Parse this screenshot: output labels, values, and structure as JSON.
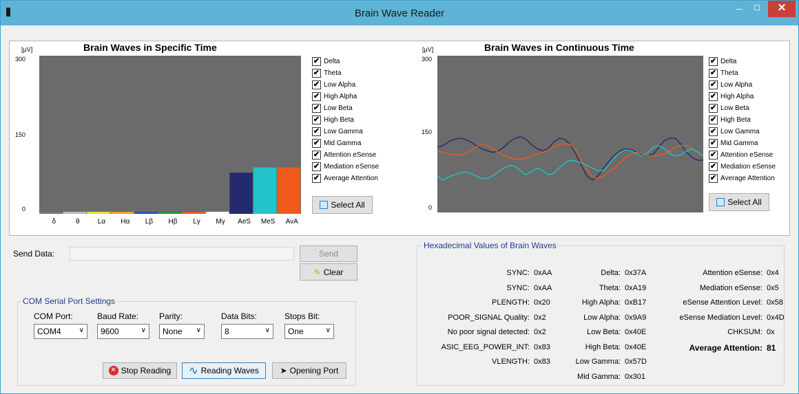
{
  "window": {
    "title": "Brain Wave Reader",
    "min": "–",
    "max": "☐",
    "close": "✕"
  },
  "chart_data": [
    {
      "type": "bar",
      "title": "Brain Waves in Specific Time",
      "unit": "[µV]",
      "ylim": [
        0,
        300
      ],
      "yticks": [
        "300",
        "150",
        "0"
      ],
      "categories": [
        "δ",
        "θ",
        "Lα",
        "Hα",
        "Lβ",
        "Hβ",
        "Lγ",
        "Mγ",
        "AeS",
        "MeS",
        "AvA"
      ],
      "values": [
        4,
        4,
        4,
        4,
        4,
        4,
        4,
        4,
        78,
        88,
        88
      ],
      "colors": [
        "#7a7a7a",
        "#bdbdbd",
        "#e6e02a",
        "#f0a020",
        "#3050b0",
        "#2e8b3a",
        "#e85a1a",
        "#ffffff",
        "#232a6e",
        "#22c3c9",
        "#f0581e"
      ]
    },
    {
      "type": "line",
      "title": "Brain Waves in Continuous Time",
      "unit": "[µV]",
      "ylim": [
        0,
        300
      ],
      "yticks": [
        "300",
        "150",
        "0"
      ],
      "x": [
        0,
        1,
        2,
        3,
        4,
        5,
        6,
        7,
        8,
        9,
        10,
        11,
        12,
        13,
        14,
        15,
        16,
        17,
        18,
        19,
        20,
        21,
        22,
        23,
        24,
        25,
        26,
        27,
        28,
        29,
        30,
        31,
        32,
        33,
        34,
        35,
        36,
        37,
        38,
        39,
        40,
        41,
        42,
        43,
        44,
        45,
        46,
        47,
        48
      ],
      "series": [
        {
          "color": "#232a6e",
          "values": [
            125,
            128,
            135,
            140,
            142,
            140,
            135,
            128,
            122,
            118,
            115,
            118,
            125,
            135,
            142,
            145,
            140,
            130,
            122,
            118,
            122,
            135,
            142,
            140,
            130,
            112,
            90,
            70,
            62,
            70,
            85,
            98,
            110,
            118,
            122,
            120,
            115,
            110,
            108,
            112,
            125,
            138,
            142,
            142,
            130,
            115,
            105,
            100,
            100
          ]
        },
        {
          "color": "#f0581e",
          "values": [
            118,
            115,
            112,
            110,
            110,
            112,
            118,
            125,
            130,
            128,
            122,
            115,
            110,
            105,
            102,
            102,
            104,
            108,
            112,
            115,
            120,
            125,
            130,
            132,
            130,
            120,
            100,
            82,
            68,
            65,
            70,
            78,
            85,
            95,
            105,
            112,
            115,
            112,
            108,
            108,
            110,
            112,
            118,
            125,
            128,
            128,
            122,
            115,
            110
          ]
        },
        {
          "color": "#22c3c9",
          "values": [
            70,
            62,
            68,
            72,
            75,
            78,
            75,
            70,
            65,
            65,
            70,
            78,
            85,
            90,
            88,
            80,
            72,
            78,
            85,
            80,
            72,
            75,
            85,
            95,
            100,
            98,
            95,
            90,
            85,
            80,
            80,
            92,
            105,
            115,
            120,
            118,
            112,
            108,
            115,
            125,
            128,
            122,
            112,
            108,
            110,
            118,
            122,
            115,
            108
          ]
        }
      ]
    }
  ],
  "legend_left": [
    "Delta",
    "Theta",
    "Low Alpha",
    "High Alpha",
    "Low Beta",
    "High Beta",
    "Low Gamma",
    "Mid Gamma",
    "Attention eSense",
    "Mediation eSense",
    "Average Attention"
  ],
  "legend_right": [
    "Delta",
    "Theta",
    "Low Alpha",
    "High Alpha",
    "Low Beta",
    "High Beta",
    "Low Gamma",
    "Mid Gamma",
    "Attention eSense",
    "Mediation eSense",
    "Average Attention"
  ],
  "select_all": "Select All",
  "send": {
    "label": "Send Data:",
    "value": "",
    "send_button": "Send",
    "clear_button": "Clear"
  },
  "com": {
    "group_title": "COM Serial Port Settings",
    "fields": [
      {
        "label": "COM Port:",
        "value": "COM4"
      },
      {
        "label": "Baud Rate:",
        "value": "9600"
      },
      {
        "label": "Parity:",
        "value": "None"
      },
      {
        "label": "Data Bits:",
        "value": "8"
      },
      {
        "label": "Stops Bit:",
        "value": "One"
      }
    ],
    "buttons": {
      "stop": "Stop Reading",
      "reading": "Reading Waves",
      "opening": "Opening Port"
    }
  },
  "hex": {
    "group_title": "Hexadecimal Values of Brain Waves",
    "col1": [
      {
        "k": "SYNC:",
        "v": "0xAA"
      },
      {
        "k": "SYNC:",
        "v": "0xAA"
      },
      {
        "k": "PLENGTH:",
        "v": "0x20"
      },
      {
        "k": "POOR_SIGNAL Quality:",
        "v": "0x2"
      },
      {
        "k": "No poor signal detected:",
        "v": "0x2"
      },
      {
        "k": "ASIC_EEG_POWER_INT:",
        "v": "0x83"
      },
      {
        "k": "VLENGTH:",
        "v": "0x83"
      }
    ],
    "col2": [
      {
        "k": "Delta:",
        "v": "0x37A"
      },
      {
        "k": "Theta:",
        "v": "0xA19"
      },
      {
        "k": "High Alpha:",
        "v": "0xB17"
      },
      {
        "k": "Low Alpha:",
        "v": "0x9A9"
      },
      {
        "k": "Low Beta:",
        "v": "0x40E"
      },
      {
        "k": "High Beta:",
        "v": "0x40E"
      },
      {
        "k": "Low Gamma:",
        "v": "0x57D"
      },
      {
        "k": "Mid Gamma:",
        "v": "0x301"
      }
    ],
    "col3": [
      {
        "k": "Attention eSense:",
        "v": "0x4"
      },
      {
        "k": "Mediation eSense:",
        "v": "0x5"
      },
      {
        "k": "eSense Attention Level:",
        "v": "0x58"
      },
      {
        "k": "eSense Mediation Level:",
        "v": "0x4D"
      },
      {
        "k": "CHKSUM:",
        "v": "0x"
      },
      {
        "k": "Average Attention:",
        "v": "81"
      }
    ]
  }
}
